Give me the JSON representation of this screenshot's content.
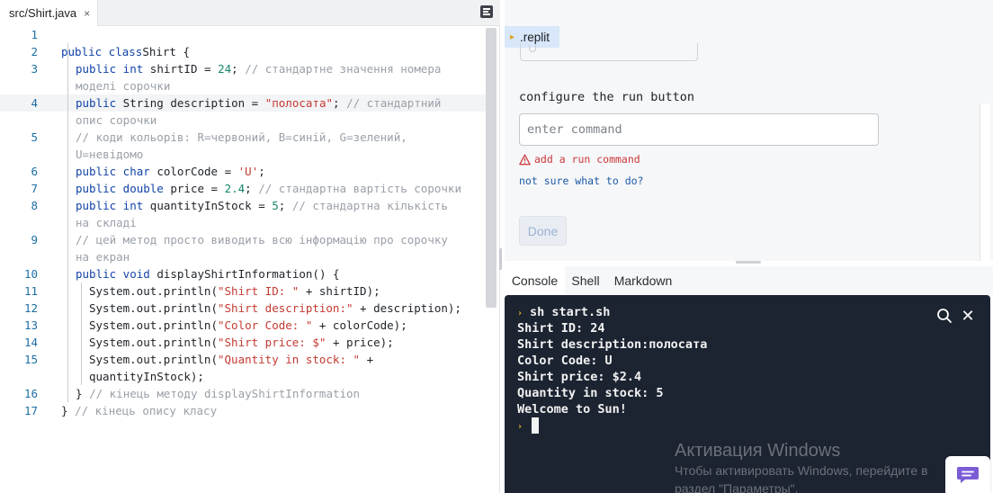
{
  "editor": {
    "tab_label": "src/Shirt.java",
    "tab_close_glyph": "×",
    "menu_icon": "format-icon",
    "lines": [
      {
        "num": "1",
        "tokens": []
      },
      {
        "num": "2",
        "tokens": [
          [
            "kw",
            "public class"
          ],
          [
            "",
            "Shirt {"
          ]
        ]
      },
      {
        "num": "3",
        "tokens": [
          [
            "kw",
            "public int"
          ],
          [
            "",
            " shirtID = "
          ],
          [
            "num",
            "24"
          ],
          [
            "",
            "; "
          ],
          [
            "cmt",
            "// стандартне значення номера"
          ]
        ]
      },
      {
        "num": "",
        "tokens": [
          [
            "cmt",
            "моделі сорочки"
          ]
        ]
      },
      {
        "num": "4",
        "tokens": [
          [
            "kw",
            "public"
          ],
          [
            "",
            " String description = "
          ],
          [
            "str",
            "\"полосата\""
          ],
          [
            "",
            "; "
          ],
          [
            "cmt",
            "// стандартний"
          ]
        ]
      },
      {
        "num": "",
        "tokens": [
          [
            "cmt",
            "опис сорочки"
          ]
        ]
      },
      {
        "num": "5",
        "tokens": [
          [
            "cmt",
            "// коди кольорів: R=червоний, B=синій, G=зелений,"
          ]
        ]
      },
      {
        "num": "",
        "tokens": [
          [
            "cmt",
            "U=невідомо"
          ]
        ]
      },
      {
        "num": "6",
        "tokens": [
          [
            "kw",
            "public char"
          ],
          [
            "",
            " colorCode = "
          ],
          [
            "str",
            "'U'"
          ],
          [
            "",
            ";"
          ]
        ]
      },
      {
        "num": "7",
        "tokens": [
          [
            "kw",
            "public double"
          ],
          [
            "",
            " price = "
          ],
          [
            "num",
            "2.4"
          ],
          [
            "",
            "; "
          ],
          [
            "cmt",
            "// стандартна вартість сорочки"
          ]
        ]
      },
      {
        "num": "8",
        "tokens": [
          [
            "kw",
            "public int"
          ],
          [
            "",
            " quantityInStock = "
          ],
          [
            "num",
            "5"
          ],
          [
            "",
            "; "
          ],
          [
            "cmt",
            "// стандартна кількість"
          ]
        ]
      },
      {
        "num": "",
        "tokens": [
          [
            "cmt",
            "на складі"
          ]
        ]
      },
      {
        "num": "9",
        "tokens": [
          [
            "cmt",
            "// цей метод просто виводить всю інформацію про сорочку"
          ]
        ]
      },
      {
        "num": "",
        "tokens": [
          [
            "cmt",
            "на екран"
          ]
        ]
      },
      {
        "num": "10",
        "tokens": [
          [
            "kw",
            "public void"
          ],
          [
            "",
            " displayShirtInformation() {"
          ]
        ]
      },
      {
        "num": "11",
        "tokens": [
          [
            "",
            "System.out.println("
          ],
          [
            "str",
            "\"Shirt ID: \""
          ],
          [
            "",
            " + shirtID);"
          ]
        ]
      },
      {
        "num": "12",
        "tokens": [
          [
            "",
            "System.out.println("
          ],
          [
            "str",
            "\"Shirt description:\""
          ],
          [
            "",
            " + description);"
          ]
        ]
      },
      {
        "num": "13",
        "tokens": [
          [
            "",
            "System.out.println("
          ],
          [
            "str",
            "\"Color Code: \""
          ],
          [
            "",
            " + colorCode);"
          ]
        ]
      },
      {
        "num": "14",
        "tokens": [
          [
            "",
            "System.out.println("
          ],
          [
            "str",
            "\"Shirt price: $\""
          ],
          [
            "",
            " + price);"
          ]
        ]
      },
      {
        "num": "15",
        "tokens": [
          [
            "",
            "System.out.println("
          ],
          [
            "str",
            "\"Quantity in stock: \""
          ],
          [
            "",
            " +"
          ]
        ]
      },
      {
        "num": "",
        "tokens": [
          [
            "",
            "quantityInStock);"
          ]
        ]
      },
      {
        "num": "16",
        "tokens": [
          [
            "",
            "} "
          ],
          [
            "cmt",
            "// кінець методу displayShirtInformation"
          ]
        ]
      },
      {
        "num": "17",
        "tokens": [
          [
            "",
            "} "
          ],
          [
            "cmt",
            "// кінець опису класу"
          ]
        ]
      }
    ]
  },
  "replit": {
    "tab_label": ".replit",
    "heading": "configure the run button",
    "input_placeholder": "enter command",
    "error_text": "add a run command",
    "help_link": "not sure what to do?",
    "done_label": "Done"
  },
  "bottom_tabs": [
    {
      "label": "Console",
      "active": true
    },
    {
      "label": "Shell",
      "active": false
    },
    {
      "label": "Markdown",
      "active": false
    }
  ],
  "console": {
    "prompt_glyph": "›",
    "command": "sh start.sh",
    "output": [
      "Shirt ID: 24",
      "Shirt description:полосата",
      "Color Code: U",
      "Shirt price: $2.4",
      "Quantity in stock: 5",
      "Welcome to Sun!"
    ],
    "close_glyph": "✕"
  },
  "watermark": {
    "title": "Активация Windows",
    "line1": "Чтобы активировать Windows, перейдите в",
    "line2": "раздел \"Параметры\"."
  },
  "colors": {
    "keyword": "#1344a8",
    "string": "#c43a31",
    "number": "#16866b",
    "comment": "#9aa0a8",
    "line_number": "#1c6ea4",
    "console_bg": "#1c2331",
    "prompt": "#e4ad2f",
    "error": "#c9373a"
  }
}
